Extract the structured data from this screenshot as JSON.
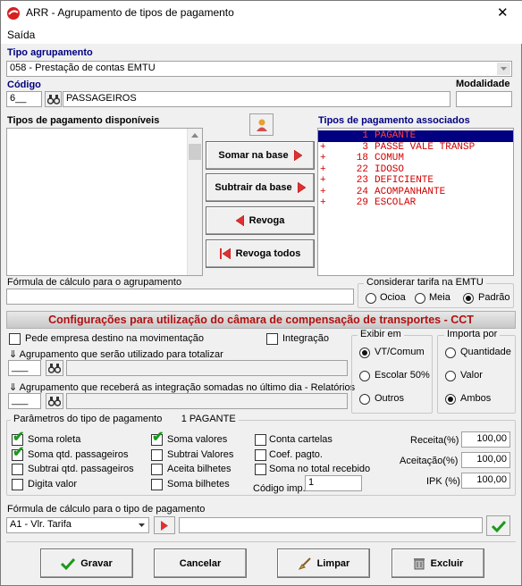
{
  "window": {
    "title": "ARR - Agrupamento de tipos de pagamento",
    "close_glyph": "✕"
  },
  "menu": {
    "saida": "Saída"
  },
  "tipo_agrupamento": {
    "label": "Tipo agrupamento",
    "value": "058 - Prestação de contas EMTU"
  },
  "codigo": {
    "label": "Código",
    "value": "6__",
    "descricao": "PASSAGEIROS"
  },
  "modalidade": {
    "label": "Modalidade",
    "value": ""
  },
  "disponiveis": {
    "label": "Tipos de pagamento disponíveis"
  },
  "associados": {
    "label": "Tipos de pagamento associados",
    "items": [
      {
        "prefix": "",
        "code": "1",
        "name": "PAGANTE"
      },
      {
        "prefix": "+",
        "code": "3",
        "name": "PASSE VALE TRANSP"
      },
      {
        "prefix": "+",
        "code": "18",
        "name": "COMUM"
      },
      {
        "prefix": "+",
        "code": "22",
        "name": "IDOSO"
      },
      {
        "prefix": "+",
        "code": "23",
        "name": "DEFICIENTE"
      },
      {
        "prefix": "+",
        "code": "24",
        "name": "ACOMPANHANTE"
      },
      {
        "prefix": "+",
        "code": "29",
        "name": "ESCOLAR"
      }
    ]
  },
  "buttons": {
    "somar": "Somar  na base",
    "subtrair": "Subtrair da base",
    "revoga": "Revoga",
    "revoga_todos": "Revoga todos",
    "gravar": "Gravar",
    "cancelar": "Cancelar",
    "limpar": "Limpar",
    "excluir": "Excluir"
  },
  "formula_agrupamento": {
    "label": "Fórmula de cálculo para o agrupamento",
    "value": ""
  },
  "considerar_tarifa": {
    "label": "Considerar tarifa na EMTU",
    "options": [
      "Ocioa",
      "Meia",
      "Padrão"
    ],
    "selected": "Padrão"
  },
  "cct": {
    "header": "Configurações para utilização do câmara de compensação de transportes - CCT",
    "pede_empresa": "Pede empresa destino na movimentação",
    "integracao": "Integração",
    "agrup_totalizar": "Agrupamento que serão utilizado para totalizar",
    "agrup_integracao": "Agrupamento que receberá as integração somadas no último dia - Relatórios",
    "code1": "___",
    "code2": "___",
    "exibir_em": {
      "label": "Exibir em",
      "options": [
        "VT/Comum",
        "Escolar 50%",
        "Outros"
      ],
      "selected": "VT/Comum"
    },
    "importa_por": {
      "label": "Importa por",
      "options": [
        "Quantidade",
        "Valor",
        "Ambos"
      ],
      "selected": "Ambos"
    }
  },
  "parametros": {
    "label": "Parâmetros do tipo de pagamento",
    "tipo": "1 PAGANTE",
    "col1": [
      {
        "label": "Soma roleta",
        "checked": true
      },
      {
        "label": "Soma qtd. passageiros",
        "checked": true
      },
      {
        "label": "Subtrai qtd. passageiros",
        "checked": false
      },
      {
        "label": "Digita valor",
        "checked": false
      }
    ],
    "col2": [
      {
        "label": "Soma valores",
        "checked": true
      },
      {
        "label": "Subtrai Valores",
        "checked": false
      },
      {
        "label": "Aceita bilhetes",
        "checked": false
      },
      {
        "label": "Soma bilhetes",
        "checked": false
      }
    ],
    "col3": [
      {
        "label": "Conta cartelas",
        "checked": false
      },
      {
        "label": "Coef. pagto.",
        "checked": false
      },
      {
        "label": "Soma no total recebido",
        "checked": false
      }
    ],
    "codigo_imp_label": "Código imp.",
    "codigo_imp_value": "1",
    "receita_label": "Receita(%)",
    "receita_value": "100,00",
    "aceitacao_label": "Aceitação(%)",
    "aceitacao_value": "100,00",
    "ipk_label": "IPK (%)",
    "ipk_value": "100,00"
  },
  "formula_tipo": {
    "label": "Fórmula de cálculo para o tipo de pagamento",
    "selected": "A1 - Vlr. Tarifa",
    "value": ""
  }
}
